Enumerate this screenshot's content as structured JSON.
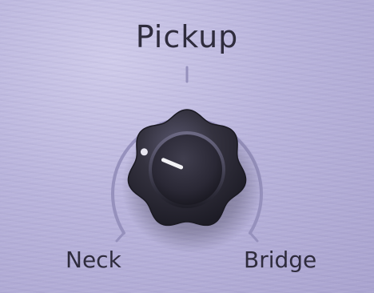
{
  "control": {
    "title": "Pickup",
    "min_label": "Neck",
    "max_label": "Bridge",
    "value": 0.25
  },
  "colors": {
    "panel": "#b9b4dc",
    "knob": "#2a2838",
    "pointer": "#f2f2f5",
    "text": "#2f2c3d"
  },
  "icons": {
    "dot": "position-dot-icon"
  }
}
